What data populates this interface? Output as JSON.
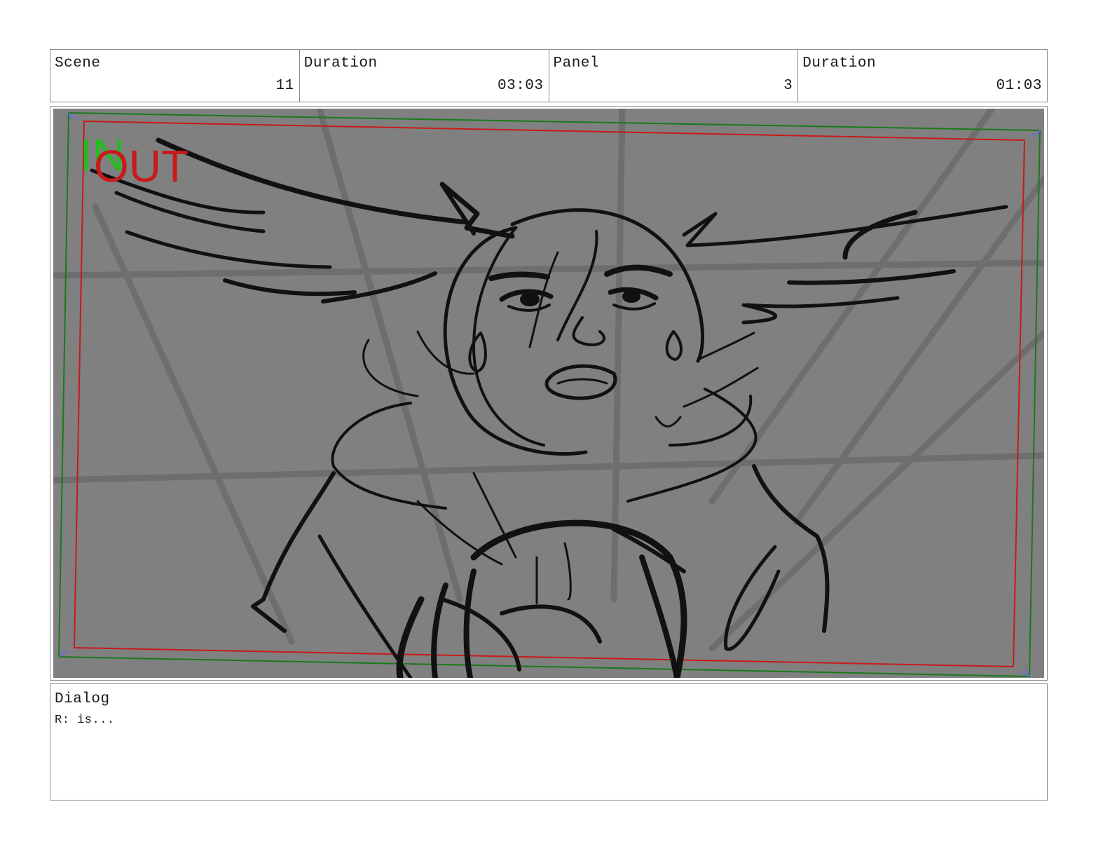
{
  "header": {
    "scene": {
      "label": "Scene",
      "value": "11"
    },
    "scene_duration": {
      "label": "Duration",
      "value": "03:03"
    },
    "panel": {
      "label": "Panel",
      "value": "3"
    },
    "panel_duration": {
      "label": "Duration",
      "value": "01:03"
    }
  },
  "panel_image": {
    "in_marker": "IN",
    "out_marker": "OUT",
    "background_color": "#808080",
    "in_frame_color": "#1a7a1a",
    "out_frame_color": "#c81a1a",
    "line_color": "#111111"
  },
  "dialog": {
    "label": "Dialog",
    "text": "R: is..."
  }
}
